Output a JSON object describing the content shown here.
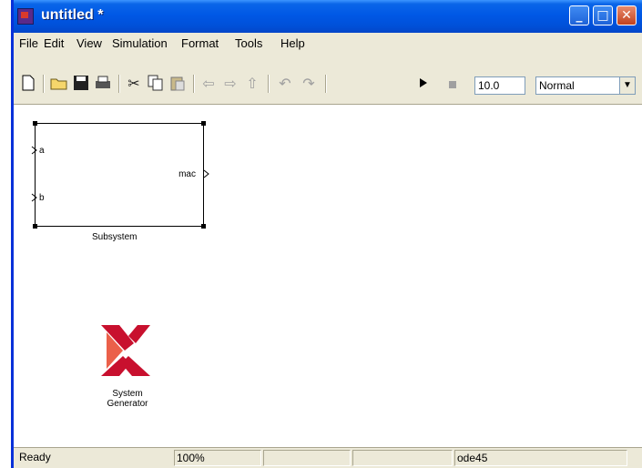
{
  "window": {
    "title": "untitled *",
    "controls": {
      "minimize": "_",
      "maximize": "□",
      "close": "✕"
    }
  },
  "menubar": {
    "items": [
      {
        "label": "File"
      },
      {
        "label": "Edit"
      },
      {
        "label": "View"
      },
      {
        "label": "Simulation"
      },
      {
        "label": "Format"
      },
      {
        "label": "Tools"
      },
      {
        "label": "Help"
      }
    ]
  },
  "toolbar": {
    "icons": [
      "new-model-icon",
      "open-icon",
      "save-icon",
      "print-icon",
      "cut-icon",
      "copy-icon",
      "paste-icon",
      "back-icon",
      "forward-icon",
      "up-icon",
      "undo-icon",
      "redo-icon",
      "start-simulation-icon",
      "stop-simulation-icon"
    ],
    "stop_time": "10.0",
    "sim_mode": "Normal"
  },
  "canvas": {
    "subsystem": {
      "name": "Subsystem",
      "inputs": [
        "a",
        "b"
      ],
      "outputs": [
        "mac"
      ]
    },
    "logo": {
      "line1": "System",
      "line2": "Generator"
    }
  },
  "statusbar": {
    "status": "Ready",
    "zoom": "100%",
    "cell3": "",
    "cell4": "",
    "solver": "ode45"
  },
  "colors": {
    "titlebar": "#0058e6",
    "logo_red": "#c8102e",
    "logo_orange": "#e8442a"
  }
}
